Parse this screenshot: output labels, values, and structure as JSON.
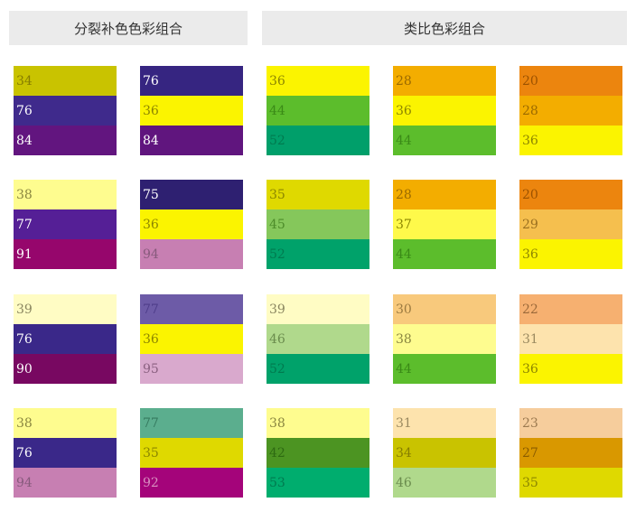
{
  "headers": {
    "split_complementary": "分裂补色色彩组合",
    "analogous": "类比色彩组合"
  },
  "swatches": [
    {
      "cells": [
        {
          "label": "34",
          "bg": "#c9c300",
          "fg": "#867d00"
        },
        {
          "label": "76",
          "bg": "#3f2a8c",
          "fg": "#ffffff"
        },
        {
          "label": "84",
          "bg": "#62157f",
          "fg": "#ffffff"
        }
      ]
    },
    {
      "cells": [
        {
          "label": "76",
          "bg": "#362581",
          "fg": "#ffffff"
        },
        {
          "label": "36",
          "bg": "#fbf400",
          "fg": "#8c8500"
        },
        {
          "label": "84",
          "bg": "#60157e",
          "fg": "#ffffff"
        }
      ]
    },
    {
      "cells": [
        {
          "label": "36",
          "bg": "#fbf400",
          "fg": "#8c8500"
        },
        {
          "label": "44",
          "bg": "#5cbd2c",
          "fg": "#3a8a17"
        },
        {
          "label": "52",
          "bg": "#009f6a",
          "fg": "#007a4f"
        }
      ]
    },
    {
      "cells": [
        {
          "label": "28",
          "bg": "#f3ad00",
          "fg": "#9b6a00"
        },
        {
          "label": "36",
          "bg": "#fbf400",
          "fg": "#8c8500"
        },
        {
          "label": "44",
          "bg": "#5cbd2c",
          "fg": "#3a8a17"
        }
      ]
    },
    {
      "cells": [
        {
          "label": "20",
          "bg": "#ec850e",
          "fg": "#9c5200"
        },
        {
          "label": "28",
          "bg": "#f3ad00",
          "fg": "#9b6a00"
        },
        {
          "label": "36",
          "bg": "#fbf400",
          "fg": "#8c8500"
        }
      ]
    },
    {
      "cells": [
        {
          "label": "38",
          "bg": "#fefc8f",
          "fg": "#8a8640"
        },
        {
          "label": "77",
          "bg": "#551f96",
          "fg": "#ffffff"
        },
        {
          "label": "91",
          "bg": "#96066c",
          "fg": "#ffffff"
        }
      ]
    },
    {
      "cells": [
        {
          "label": "75",
          "bg": "#2e2071",
          "fg": "#ffffff"
        },
        {
          "label": "36",
          "bg": "#fbf400",
          "fg": "#8c8500"
        },
        {
          "label": "94",
          "bg": "#c77fb2",
          "fg": "#875a7c"
        }
      ]
    },
    {
      "cells": [
        {
          "label": "35",
          "bg": "#dfd900",
          "fg": "#8c8700"
        },
        {
          "label": "45",
          "bg": "#85c75b",
          "fg": "#4d8c2a"
        },
        {
          "label": "52",
          "bg": "#00a26a",
          "fg": "#007a4f"
        }
      ]
    },
    {
      "cells": [
        {
          "label": "28",
          "bg": "#f3ad00",
          "fg": "#9b6a00"
        },
        {
          "label": "37",
          "bg": "#fef94a",
          "fg": "#8c8700"
        },
        {
          "label": "44",
          "bg": "#5cbd2c",
          "fg": "#3a8a17"
        }
      ]
    },
    {
      "cells": [
        {
          "label": "20",
          "bg": "#ec850e",
          "fg": "#9c5200"
        },
        {
          "label": "29",
          "bg": "#f5bf4e",
          "fg": "#9b7020"
        },
        {
          "label": "36",
          "bg": "#fbf400",
          "fg": "#8c8500"
        }
      ]
    },
    {
      "cells": [
        {
          "label": "39",
          "bg": "#fffcc4",
          "fg": "#8a8660"
        },
        {
          "label": "76",
          "bg": "#3a2889",
          "fg": "#ffffff"
        },
        {
          "label": "90",
          "bg": "#780861",
          "fg": "#ffffff"
        }
      ]
    },
    {
      "cells": [
        {
          "label": "77",
          "bg": "#6d5ba7",
          "fg": "#4e3d8a"
        },
        {
          "label": "36",
          "bg": "#fbf400",
          "fg": "#8c8500"
        },
        {
          "label": "95",
          "bg": "#d9a9cd",
          "fg": "#8a6080"
        }
      ]
    },
    {
      "cells": [
        {
          "label": "39",
          "bg": "#fffcc4",
          "fg": "#8a8660"
        },
        {
          "label": "46",
          "bg": "#b0d98c",
          "fg": "#6a8c4d"
        },
        {
          "label": "52",
          "bg": "#00a26a",
          "fg": "#007a4f"
        }
      ]
    },
    {
      "cells": [
        {
          "label": "30",
          "bg": "#f8c97c",
          "fg": "#9b7a40"
        },
        {
          "label": "38",
          "bg": "#fefc8f",
          "fg": "#8a8640"
        },
        {
          "label": "44",
          "bg": "#5cbd2c",
          "fg": "#3a8a17"
        }
      ]
    },
    {
      "cells": [
        {
          "label": "22",
          "bg": "#f6b070",
          "fg": "#9c6a3a"
        },
        {
          "label": "31",
          "bg": "#fde3ad",
          "fg": "#9b8a60"
        },
        {
          "label": "36",
          "bg": "#fbf400",
          "fg": "#8c8500"
        }
      ]
    },
    {
      "cells": [
        {
          "label": "38",
          "bg": "#fefc8f",
          "fg": "#8a8640"
        },
        {
          "label": "76",
          "bg": "#3a2889",
          "fg": "#ffffff"
        },
        {
          "label": "94",
          "bg": "#c77fb2",
          "fg": "#875a7c"
        }
      ]
    },
    {
      "cells": [
        {
          "label": "77",
          "bg": "#5bae8e",
          "fg": "#357a5f"
        },
        {
          "label": "35",
          "bg": "#dfd900",
          "fg": "#8c8700"
        },
        {
          "label": "92",
          "bg": "#a4047a",
          "fg": "#d890c0"
        }
      ]
    },
    {
      "cells": [
        {
          "label": "38",
          "bg": "#fefc8f",
          "fg": "#8a8640"
        },
        {
          "label": "42",
          "bg": "#4c9422",
          "fg": "#2e6a12"
        },
        {
          "label": "53",
          "bg": "#00ad6e",
          "fg": "#007a4f"
        }
      ]
    },
    {
      "cells": [
        {
          "label": "31",
          "bg": "#fde3ad",
          "fg": "#9b8a60"
        },
        {
          "label": "34",
          "bg": "#c9c300",
          "fg": "#867d00"
        },
        {
          "label": "46",
          "bg": "#b0d98c",
          "fg": "#6a8c4d"
        }
      ]
    },
    {
      "cells": [
        {
          "label": "23",
          "bg": "#f6cd9c",
          "fg": "#9c7a50"
        },
        {
          "label": "27",
          "bg": "#d99800",
          "fg": "#8a5c00"
        },
        {
          "label": "35",
          "bg": "#dfd900",
          "fg": "#8c8700"
        }
      ]
    }
  ]
}
